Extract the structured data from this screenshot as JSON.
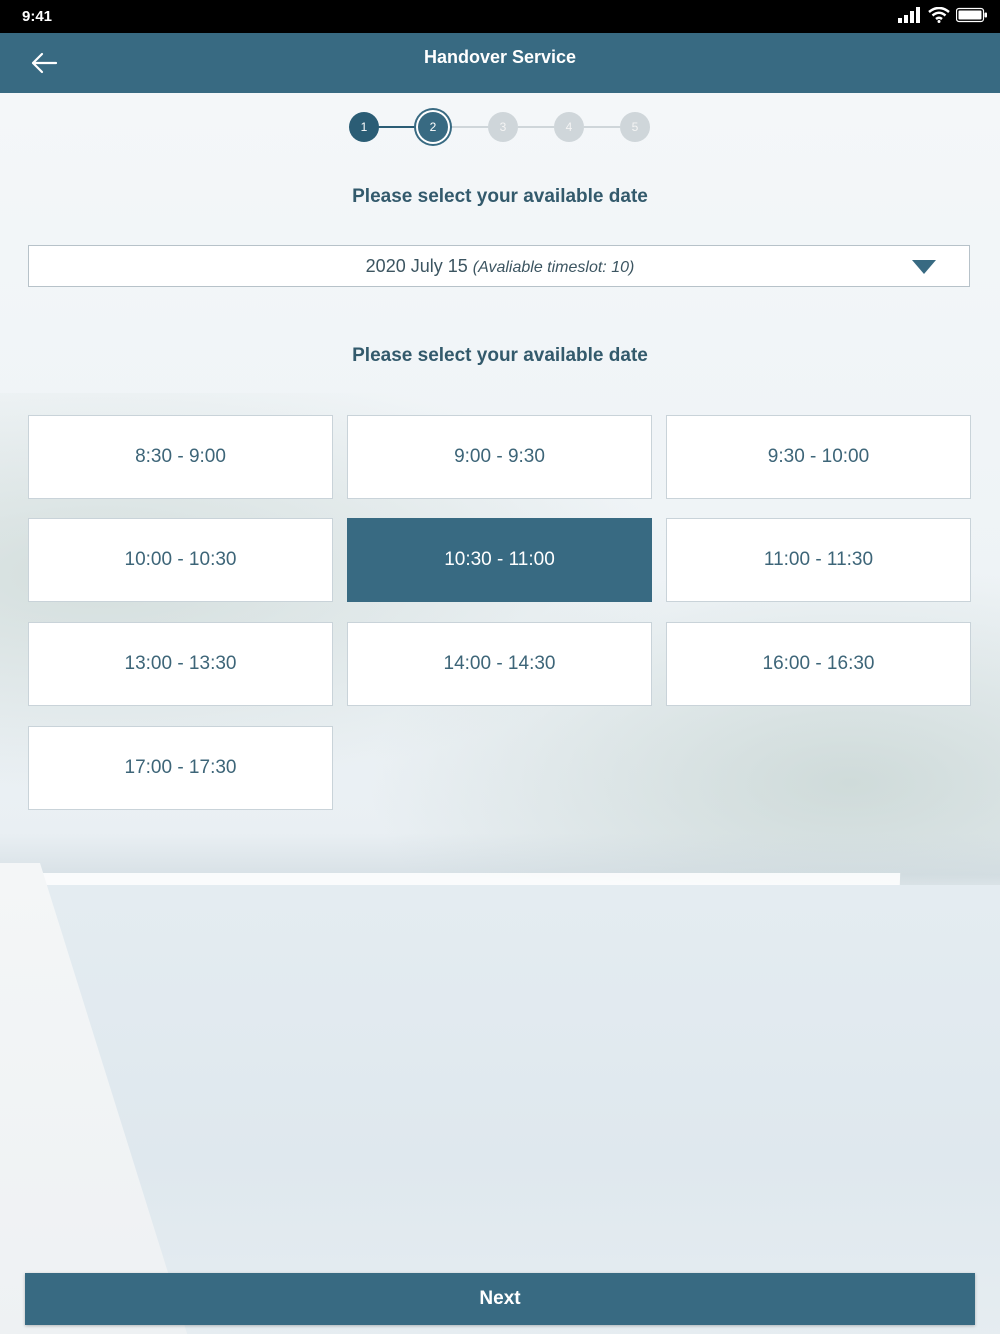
{
  "status_bar": {
    "time": "9:41"
  },
  "header": {
    "title": "Handover Service",
    "back_icon": "arrow-left-icon"
  },
  "stepper": {
    "steps": [
      "1",
      "2",
      "3",
      "4",
      "5"
    ],
    "current_step": 2
  },
  "date_section": {
    "label": "Please select your available date",
    "selected_date": "2020 July 15",
    "selected_date_note": "(Avaliable timeslot: 10)"
  },
  "time_section": {
    "label": "Please select your available date",
    "slots": [
      "8:30 - 9:00",
      "9:00 - 9:30",
      "9:30 - 10:00",
      "10:00 - 10:30",
      "10:30 - 11:00",
      "11:00 - 11:30",
      "13:00 - 13:30",
      "14:00 - 14:30",
      "16:00 - 16:30",
      "17:00 - 17:30"
    ],
    "selected_slot": "10:30 - 11:00"
  },
  "footer": {
    "next_label": "Next"
  },
  "colors": {
    "primary": "#386a82",
    "text": "#335a6c",
    "inactive_step": "#cfd6da"
  }
}
